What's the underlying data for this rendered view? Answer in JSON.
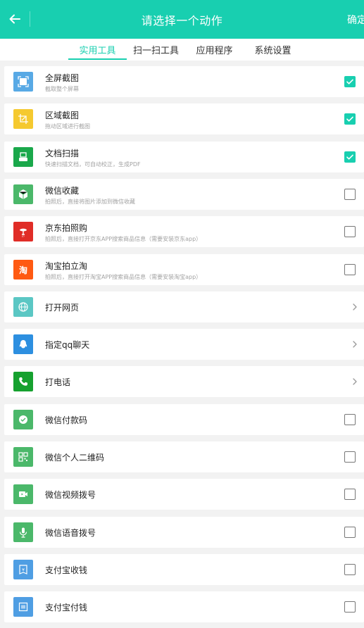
{
  "header": {
    "title": "请选择一个动作",
    "confirm_label": "确定",
    "background": "#18cfb0"
  },
  "tabs": [
    {
      "label": "实用工具",
      "active": true
    },
    {
      "label": "扫一扫工具",
      "active": false
    },
    {
      "label": "应用程序",
      "active": false
    },
    {
      "label": "系统设置",
      "active": false
    }
  ],
  "items": [
    {
      "title": "全屏截图",
      "subtitle": "截取整个屏幕",
      "icon": "fullscreen-crop-icon",
      "icon_color": "#58a9e5",
      "control": "checkbox",
      "checked": true
    },
    {
      "title": "区域截图",
      "subtitle": "拖动区域进行截图",
      "icon": "region-crop-icon",
      "icon_color": "#f5c92f",
      "control": "checkbox",
      "checked": true
    },
    {
      "title": "文档扫描",
      "subtitle": "快速扫描文档，可自动校正，生成PDF",
      "icon": "document-scanner-icon",
      "icon_color": "#1aa84b",
      "control": "checkbox",
      "checked": true
    },
    {
      "title": "微信收藏",
      "subtitle": "拍照后，直接将图片添加到微信收藏",
      "icon": "wechat-favorite-cube-icon",
      "icon_color": "#4bb86a",
      "control": "checkbox",
      "checked": false
    },
    {
      "title": "京东拍照购",
      "subtitle": "拍照后，直接打开京东APP搜索商品信息（需要安装京东app）",
      "icon": "jd-logo-icon",
      "icon_color": "#e02d27",
      "control": "checkbox",
      "checked": false
    },
    {
      "title": "淘宝拍立淘",
      "subtitle": "拍照后，直接打开淘宝APP搜索商品信息（需要安装淘宝app）",
      "icon": "taobao-logo-icon",
      "icon_color": "#ff5a12",
      "control": "checkbox",
      "checked": false
    },
    {
      "title": "打开网页",
      "subtitle": "",
      "icon": "globe-icon",
      "icon_color": "#5bc7c4",
      "control": "chevron"
    },
    {
      "title": "指定qq聊天",
      "subtitle": "",
      "icon": "qq-penguin-icon",
      "icon_color": "#2d8fe0",
      "control": "chevron"
    },
    {
      "title": "打电话",
      "subtitle": "",
      "icon": "phone-icon",
      "icon_color": "#16a12f",
      "control": "chevron"
    },
    {
      "title": "微信付款码",
      "subtitle": "",
      "icon": "wechat-pay-icon",
      "icon_color": "#4bb86a",
      "control": "checkbox",
      "checked": false
    },
    {
      "title": "微信个人二维码",
      "subtitle": "",
      "icon": "qr-code-icon",
      "icon_color": "#4bb86a",
      "control": "checkbox",
      "checked": false
    },
    {
      "title": "微信视频拨号",
      "subtitle": "",
      "icon": "video-call-icon",
      "icon_color": "#4bb86a",
      "control": "checkbox",
      "checked": false
    },
    {
      "title": "微信语音拨号",
      "subtitle": "",
      "icon": "microphone-icon",
      "icon_color": "#4bb86a",
      "control": "checkbox",
      "checked": false
    },
    {
      "title": "支付宝收钱",
      "subtitle": "",
      "icon": "alipay-receive-icon",
      "icon_color": "#4f9ee3",
      "control": "checkbox",
      "checked": false
    },
    {
      "title": "支付宝付钱",
      "subtitle": "",
      "icon": "alipay-pay-icon",
      "icon_color": "#4f9ee3",
      "control": "checkbox",
      "checked": false
    }
  ]
}
